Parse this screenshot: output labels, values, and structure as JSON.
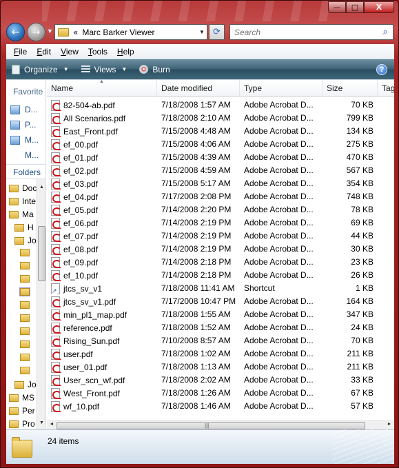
{
  "window": {
    "caption_buttons": {
      "minimize": "—",
      "maximize": "□",
      "close": "X"
    }
  },
  "nav": {
    "back_glyph": "←",
    "forward_glyph": "→",
    "address_chevron": "«",
    "address_path": "Marc Barker Viewer",
    "search_placeholder": "Search"
  },
  "menu": {
    "items": [
      {
        "label": "File",
        "u": "F",
        "rest": "ile"
      },
      {
        "label": "Edit",
        "u": "E",
        "rest": "dit"
      },
      {
        "label": "View",
        "u": "V",
        "rest": "iew"
      },
      {
        "label": "Tools",
        "u": "T",
        "rest": "ools"
      },
      {
        "label": "Help",
        "u": "H",
        "rest": "elp"
      }
    ]
  },
  "toolbar": {
    "organize": "Organize",
    "views": "Views",
    "burn": "Burn",
    "help": "?"
  },
  "navpane": {
    "favorites_header": "Favorite l",
    "favorites": [
      "D...",
      "P...",
      "M...",
      "M..."
    ],
    "folders_header": "Folders",
    "tree": [
      "Doc",
      "Inte",
      "Ma",
      "H",
      "Jo",
      "",
      "",
      "",
      "",
      "",
      "",
      "",
      "",
      "",
      "",
      "Jo",
      "MS",
      "Per",
      "Pro"
    ]
  },
  "columns": {
    "name": "Name",
    "date": "Date modified",
    "type": "Type",
    "size": "Size",
    "tags": "Tag"
  },
  "files": [
    {
      "name": "82-504-ab.pdf",
      "date": "7/18/2008 1:57 AM",
      "type": "Adobe Acrobat D...",
      "size": "70 KB",
      "icon": "pdf-icon"
    },
    {
      "name": "All Scenarios.pdf",
      "date": "7/18/2008 2:10 AM",
      "type": "Adobe Acrobat D...",
      "size": "799 KB",
      "icon": "pdf-icon"
    },
    {
      "name": "East_Front.pdf",
      "date": "7/15/2008 4:48 AM",
      "type": "Adobe Acrobat D...",
      "size": "134 KB",
      "icon": "pdf-icon"
    },
    {
      "name": "ef_00.pdf",
      "date": "7/15/2008 4:06 AM",
      "type": "Adobe Acrobat D...",
      "size": "275 KB",
      "icon": "pdf-icon"
    },
    {
      "name": "ef_01.pdf",
      "date": "7/15/2008 4:39 AM",
      "type": "Adobe Acrobat D...",
      "size": "470 KB",
      "icon": "pdf-icon"
    },
    {
      "name": "ef_02.pdf",
      "date": "7/15/2008 4:59 AM",
      "type": "Adobe Acrobat D...",
      "size": "567 KB",
      "icon": "pdf-icon"
    },
    {
      "name": "ef_03.pdf",
      "date": "7/15/2008 5:17 AM",
      "type": "Adobe Acrobat D...",
      "size": "354 KB",
      "icon": "pdf-icon"
    },
    {
      "name": "ef_04.pdf",
      "date": "7/17/2008 2:08 PM",
      "type": "Adobe Acrobat D...",
      "size": "748 KB",
      "icon": "pdf-icon"
    },
    {
      "name": "ef_05.pdf",
      "date": "7/14/2008 2:20 PM",
      "type": "Adobe Acrobat D...",
      "size": "78 KB",
      "icon": "pdf-icon"
    },
    {
      "name": "ef_06.pdf",
      "date": "7/14/2008 2:19 PM",
      "type": "Adobe Acrobat D...",
      "size": "69 KB",
      "icon": "pdf-icon"
    },
    {
      "name": "ef_07.pdf",
      "date": "7/14/2008 2:19 PM",
      "type": "Adobe Acrobat D...",
      "size": "44 KB",
      "icon": "pdf-icon"
    },
    {
      "name": "ef_08.pdf",
      "date": "7/14/2008 2:19 PM",
      "type": "Adobe Acrobat D...",
      "size": "30 KB",
      "icon": "pdf-icon"
    },
    {
      "name": "ef_09.pdf",
      "date": "7/14/2008 2:18 PM",
      "type": "Adobe Acrobat D...",
      "size": "23 KB",
      "icon": "pdf-icon"
    },
    {
      "name": "ef_10.pdf",
      "date": "7/14/2008 2:18 PM",
      "type": "Adobe Acrobat D...",
      "size": "26 KB",
      "icon": "pdf-icon"
    },
    {
      "name": "jtcs_sv_v1",
      "date": "7/18/2008 11:41 AM",
      "type": "Shortcut",
      "size": "1 KB",
      "icon": "shortcut-icon"
    },
    {
      "name": "jtcs_sv_v1.pdf",
      "date": "7/17/2008 10:47 PM",
      "type": "Adobe Acrobat D...",
      "size": "164 KB",
      "icon": "pdf-icon"
    },
    {
      "name": "min_pl1_map.pdf",
      "date": "7/18/2008 1:55 AM",
      "type": "Adobe Acrobat D...",
      "size": "347 KB",
      "icon": "pdf-icon"
    },
    {
      "name": "reference.pdf",
      "date": "7/18/2008 1:52 AM",
      "type": "Adobe Acrobat D...",
      "size": "24 KB",
      "icon": "pdf-icon"
    },
    {
      "name": "Rising_Sun.pdf",
      "date": "7/10/2008 8:57 AM",
      "type": "Adobe Acrobat D...",
      "size": "70 KB",
      "icon": "pdf-icon"
    },
    {
      "name": "user.pdf",
      "date": "7/18/2008 1:02 AM",
      "type": "Adobe Acrobat D...",
      "size": "211 KB",
      "icon": "pdf-icon"
    },
    {
      "name": "user_01.pdf",
      "date": "7/18/2008 1:13 AM",
      "type": "Adobe Acrobat D...",
      "size": "211 KB",
      "icon": "pdf-icon"
    },
    {
      "name": "User_scn_wf.pdf",
      "date": "7/18/2008 2:02 AM",
      "type": "Adobe Acrobat D...",
      "size": "33 KB",
      "icon": "pdf-icon"
    },
    {
      "name": "West_Front.pdf",
      "date": "7/18/2008 1:26 AM",
      "type": "Adobe Acrobat D...",
      "size": "67 KB",
      "icon": "pdf-icon"
    },
    {
      "name": "wf_10.pdf",
      "date": "7/18/2008 1:46 AM",
      "type": "Adobe Acrobat D...",
      "size": "57 KB",
      "icon": "pdf-icon"
    }
  ],
  "status": {
    "item_count": "24 items"
  }
}
